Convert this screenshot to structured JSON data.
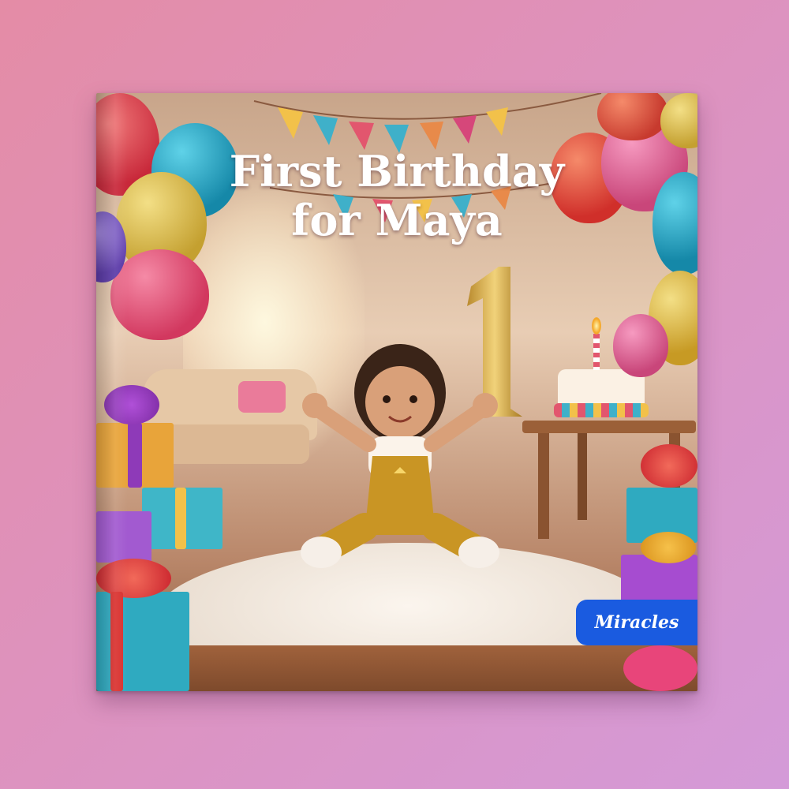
{
  "book": {
    "title_line1": "First Birthday",
    "title_line2": "for Maya",
    "brand_badge": "Miracles"
  },
  "colors": {
    "background_start": "#e48ca6",
    "background_end": "#d49ad8",
    "badge": "#1a5be0",
    "title_text": "#ffffff"
  },
  "scene": {
    "elements": [
      "balloons",
      "bunting-flags",
      "gift-boxes",
      "birthday-cake",
      "number-one-balloon",
      "sofa",
      "rug",
      "toddler"
    ]
  }
}
